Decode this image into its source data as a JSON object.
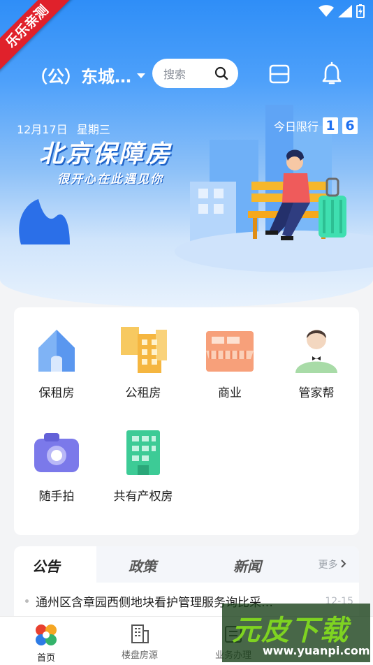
{
  "status_bar": {
    "wifi_icon": "wifi-icon",
    "signal_icon": "signal-icon",
    "battery_icon": "battery-charging-icon"
  },
  "ribbon": {
    "text": "乐乐亲测"
  },
  "header": {
    "city": "（公）东城…",
    "search_placeholder": "搜索",
    "scan_icon": "scan-icon",
    "bell_icon": "bell-icon"
  },
  "banner": {
    "date": "12月17日",
    "weekday": "星期三",
    "limit_label": "今日限行",
    "limit_numbers": [
      "1",
      "6"
    ],
    "title": "北京保障房",
    "subtitle": "很开心在此遇见你"
  },
  "categories": [
    {
      "label": "保租房",
      "icon": "house-icon"
    },
    {
      "label": "公租房",
      "icon": "apartment-buildings-icon"
    },
    {
      "label": "商业",
      "icon": "shop-icon"
    },
    {
      "label": "管家帮",
      "icon": "butler-icon"
    },
    {
      "label": "随手拍",
      "icon": "camera-icon"
    },
    {
      "label": "共有产权房",
      "icon": "office-building-icon"
    }
  ],
  "news": {
    "tabs": [
      "公告",
      "政策",
      "新闻"
    ],
    "active_tab": "公告",
    "more": "更多",
    "items": [
      {
        "title": "通州区含章园西侧地块看护管理服务询比采…",
        "date": "12-15"
      }
    ]
  },
  "nav": {
    "items": [
      {
        "label": "首页",
        "icon": "home-logo-icon"
      },
      {
        "label": "楼盘房源",
        "icon": "building-icon"
      },
      {
        "label": "业务办理",
        "icon": "business-icon"
      }
    ]
  },
  "watermark": {
    "logo": "元皮下载",
    "url": "www.yuanpi.com"
  },
  "colors": {
    "primary": "#2f8ef7",
    "accent_red": "#e0212b",
    "limit_blue": "#1d6ff0"
  }
}
